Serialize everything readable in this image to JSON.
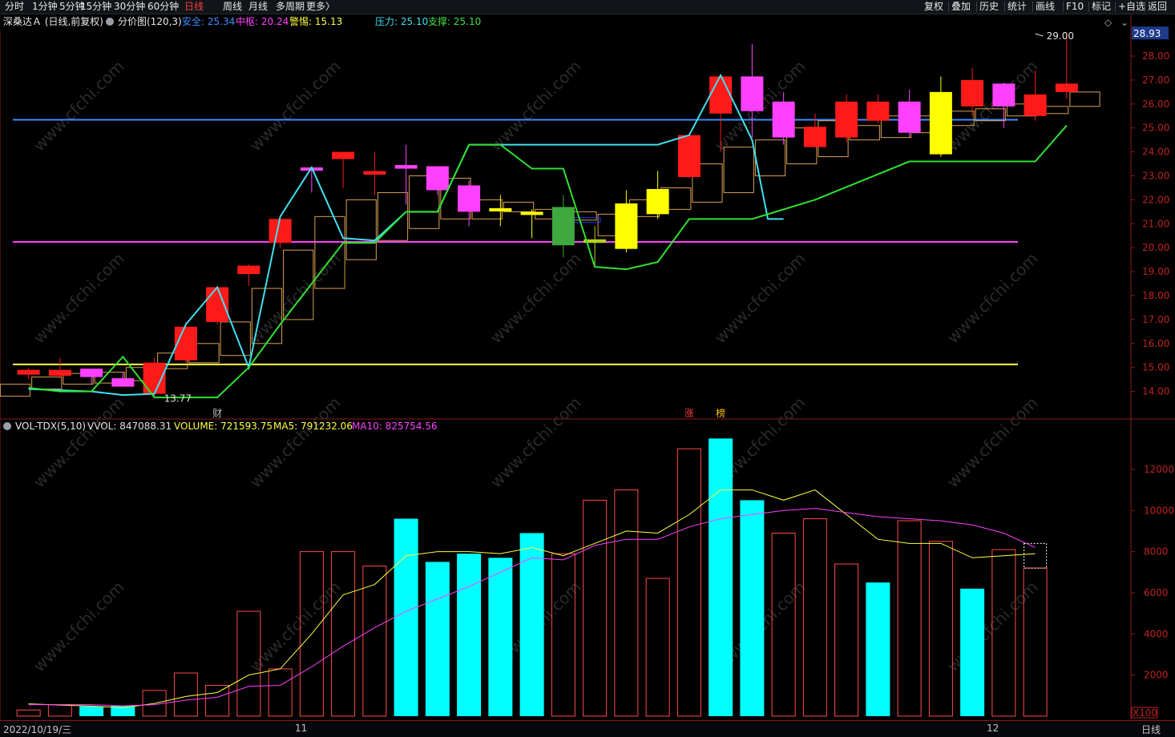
{
  "toolbar": {
    "periods": [
      "分时",
      "1分钟",
      "5分钟",
      "15分钟",
      "30分钟",
      "60分钟",
      "日线",
      "周线",
      "月线",
      "多周期",
      "更多〉"
    ],
    "active_period": "日线",
    "actions": [
      "复权",
      "叠加",
      "历史",
      "统计",
      "画线",
      "F10",
      "标记",
      "+自选",
      "返回"
    ]
  },
  "main_panel": {
    "stock": "深桑达Ａ (日线,前复权)",
    "indicator": "分价图(120,3)",
    "items": [
      {
        "label": "安全: 25.34",
        "color": "#3c8cff"
      },
      {
        "label": "中枢: 20.24",
        "color": "#ff40ff"
      },
      {
        "label": "警惕: 15.13",
        "color": "#ffff40"
      },
      {
        "label": "压力: 25.10",
        "color": "#40e0f0"
      },
      {
        "label": "支撑: 25.10",
        "color": "#40e040"
      }
    ],
    "current_price": "28.93",
    "high_label": "29.00",
    "low_label": "13.77",
    "markers": [
      {
        "text": "财",
        "color": "#bbbbbb",
        "bar": 6
      },
      {
        "text": "涨",
        "color": "#ff4040",
        "bar": 21
      },
      {
        "text": "榜",
        "color": "#ffc000",
        "bar": 22
      }
    ]
  },
  "vol_panel": {
    "title": "VOL-TDX(5,10)",
    "items": [
      {
        "label": "VVOL: 847088.31",
        "color": "#e0e0e0"
      },
      {
        "label": "VOLUME: 721593.75",
        "color": "#ffff40"
      },
      {
        "label": "MA5: 791232.06",
        "color": "#ffff40"
      },
      {
        "label": "MA10: 825754.56",
        "color": "#ff40ff"
      }
    ],
    "unit": "X100"
  },
  "bottom": {
    "date": "2022/10/19/三",
    "month_11": "11",
    "month_12": "12",
    "period": "日线"
  },
  "watermark": "www.cfchi.com",
  "chart_data": {
    "type": "candlestick",
    "price_axis": {
      "ticks": [
        "14.00",
        "15.00",
        "16.00",
        "17.00",
        "18.00",
        "19.00",
        "20.00",
        "21.00",
        "22.00",
        "23.00",
        "24.00",
        "25.00",
        "26.00",
        "27.00",
        "28.00"
      ],
      "range": [
        13.1,
        29.9
      ]
    },
    "volume_axis": {
      "ticks": [
        "2000",
        "4000",
        "6000",
        "8000",
        "10000",
        "12000"
      ],
      "range": [
        0,
        13900
      ]
    },
    "candles": [
      {
        "o": 14.7,
        "h": 14.95,
        "l": 14.5,
        "c": 14.9,
        "color": "red"
      },
      {
        "o": 14.65,
        "h": 15.4,
        "l": 14.55,
        "c": 14.9,
        "color": "red"
      },
      {
        "o": 14.6,
        "h": 14.95,
        "l": 14.3,
        "c": 14.95,
        "color": "magenta"
      },
      {
        "o": 14.2,
        "h": 14.8,
        "l": 14.2,
        "c": 14.55,
        "color": "magenta"
      },
      {
        "o": 13.9,
        "h": 15.4,
        "l": 13.8,
        "c": 15.2,
        "color": "red"
      },
      {
        "o": 15.3,
        "h": 16.9,
        "l": 15.2,
        "c": 16.7,
        "color": "red"
      },
      {
        "o": 16.9,
        "h": 18.4,
        "l": 16.8,
        "c": 18.35,
        "color": "red"
      },
      {
        "o": 18.9,
        "h": 19.3,
        "l": 18.4,
        "c": 19.25,
        "color": "red"
      },
      {
        "o": 20.2,
        "h": 21.2,
        "l": 20.0,
        "c": 21.2,
        "color": "red"
      },
      {
        "o": 23.25,
        "h": 23.4,
        "l": 22.3,
        "c": 23.35,
        "color": "magenta"
      },
      {
        "o": 23.7,
        "h": 24.0,
        "l": 22.5,
        "c": 24.0,
        "color": "red"
      },
      {
        "o": 23.05,
        "h": 24.0,
        "l": 22.2,
        "c": 23.2,
        "color": "red"
      },
      {
        "o": 23.3,
        "h": 24.3,
        "l": 21.8,
        "c": 23.45,
        "color": "magenta"
      },
      {
        "o": 22.4,
        "h": 23.4,
        "l": 22.2,
        "c": 23.4,
        "color": "magenta"
      },
      {
        "o": 22.6,
        "h": 22.8,
        "l": 20.9,
        "c": 21.5,
        "color": "magenta"
      },
      {
        "o": 21.6,
        "h": 22.2,
        "l": 20.9,
        "c": 21.65,
        "color": "yellow"
      },
      {
        "o": 21.5,
        "h": 21.6,
        "l": 20.4,
        "c": 21.5,
        "color": "yellow"
      },
      {
        "o": 21.7,
        "h": 22.2,
        "l": 19.6,
        "c": 20.1,
        "color": "green"
      },
      {
        "o": 20.2,
        "h": 20.9,
        "l": 19.2,
        "c": 20.35,
        "color": "yellowgreen"
      },
      {
        "o": 19.95,
        "h": 22.4,
        "l": 19.8,
        "c": 21.85,
        "color": "yellow"
      },
      {
        "o": 21.4,
        "h": 23.2,
        "l": 21.2,
        "c": 22.45,
        "color": "yellow"
      },
      {
        "o": 22.95,
        "h": 24.8,
        "l": 22.9,
        "c": 24.7,
        "color": "red"
      },
      {
        "o": 25.6,
        "h": 27.15,
        "l": 24.0,
        "c": 27.15,
        "color": "red"
      },
      {
        "o": 25.7,
        "h": 28.5,
        "l": 24.6,
        "c": 27.15,
        "color": "magenta"
      },
      {
        "o": 24.6,
        "h": 26.5,
        "l": 24.3,
        "c": 26.1,
        "color": "magenta"
      },
      {
        "o": 24.2,
        "h": 25.6,
        "l": 24.2,
        "c": 25.05,
        "color": "red"
      },
      {
        "o": 24.6,
        "h": 26.4,
        "l": 24.4,
        "c": 26.1,
        "color": "red"
      },
      {
        "o": 25.3,
        "h": 26.4,
        "l": 25.2,
        "c": 26.1,
        "color": "red"
      },
      {
        "o": 24.8,
        "h": 26.6,
        "l": 24.6,
        "c": 26.1,
        "color": "magenta"
      },
      {
        "o": 23.9,
        "h": 27.15,
        "l": 23.8,
        "c": 26.5,
        "color": "yellow"
      },
      {
        "o": 25.9,
        "h": 27.5,
        "l": 25.5,
        "c": 27.0,
        "color": "red"
      },
      {
        "o": 25.9,
        "h": 26.9,
        "l": 25.0,
        "c": 26.85,
        "color": "magenta"
      },
      {
        "o": 25.5,
        "h": 27.4,
        "l": 25.3,
        "c": 26.4,
        "color": "red"
      },
      {
        "o": 26.5,
        "h": 29.0,
        "l": 26.2,
        "c": 26.85,
        "color": "red"
      }
    ],
    "boxes": [
      [
        13.8,
        14.3
      ],
      [
        14.1,
        14.6
      ],
      [
        14.3,
        14.75
      ],
      [
        14.35,
        14.8
      ],
      [
        14.45,
        15.0
      ],
      [
        14.95,
        15.6
      ],
      [
        15.2,
        16.0
      ],
      [
        15.5,
        16.9
      ],
      [
        16.0,
        18.3
      ],
      [
        17.0,
        19.9
      ],
      [
        18.3,
        21.3
      ],
      [
        19.5,
        22.0
      ],
      [
        20.3,
        22.3
      ],
      [
        20.8,
        23.0
      ],
      [
        21.2,
        22.9
      ],
      [
        21.2,
        22.0
      ],
      [
        21.5,
        21.9
      ],
      [
        21.2,
        21.6
      ],
      [
        21.15,
        21.5
      ],
      [
        20.5,
        21.4
      ],
      [
        21.3,
        22.0
      ],
      [
        21.6,
        22.5
      ],
      [
        21.9,
        23.5
      ],
      [
        22.3,
        24.2
      ],
      [
        23.0,
        24.5
      ],
      [
        23.5,
        25.0
      ],
      [
        23.8,
        25.3
      ],
      [
        24.5,
        25.1
      ],
      [
        24.6,
        25.5
      ],
      [
        24.8,
        25.5
      ],
      [
        25.1,
        25.7
      ],
      [
        25.3,
        25.8
      ],
      [
        25.5,
        26.0
      ],
      [
        25.6,
        25.9
      ],
      [
        25.9,
        26.5
      ]
    ],
    "hlines": [
      {
        "name": "安全",
        "value": 25.34,
        "color": "#3c8cff"
      },
      {
        "name": "中枢",
        "value": 20.24,
        "color": "#ff40ff"
      },
      {
        "name": "警惕",
        "value": 15.13,
        "color": "#ffff40"
      }
    ],
    "pressure_line": [
      {
        "i": 0,
        "v": 14.1
      },
      {
        "i": 2,
        "v": 14.0
      },
      {
        "i": 3,
        "v": 13.85
      },
      {
        "i": 4,
        "v": 13.9
      },
      {
        "i": 5,
        "v": 16.8
      },
      {
        "i": 6,
        "v": 18.35
      },
      {
        "i": 7,
        "v": 15.0
      },
      {
        "i": 8,
        "v": 21.3
      },
      {
        "i": 9,
        "v": 23.35
      },
      {
        "i": 10,
        "v": 20.4
      },
      {
        "i": 11,
        "v": 20.3
      },
      {
        "i": 12,
        "v": 21.5
      },
      {
        "i": 13,
        "v": 21.5
      },
      {
        "i": 14,
        "v": 24.3
      },
      {
        "i": 15,
        "v": 24.3
      },
      {
        "i": 19,
        "v": 24.3
      },
      {
        "i": 20,
        "v": 24.3
      },
      {
        "i": 21,
        "v": 24.7
      },
      {
        "i": 22,
        "v": 27.2
      },
      {
        "i": 23,
        "v": 24.5
      },
      {
        "i": 23.5,
        "v": 21.2
      },
      {
        "i": 24,
        "v": 21.2
      }
    ],
    "support_line": [
      {
        "i": 0,
        "v": 14.15
      },
      {
        "i": 1,
        "v": 14.0
      },
      {
        "i": 2,
        "v": 14.0
      },
      {
        "i": 3,
        "v": 15.45
      },
      {
        "i": 4,
        "v": 13.75
      },
      {
        "i": 5,
        "v": 13.75
      },
      {
        "i": 6,
        "v": 13.75
      },
      {
        "i": 7,
        "v": 15.0
      },
      {
        "i": 8,
        "v": 16.8
      },
      {
        "i": 9,
        "v": 18.5
      },
      {
        "i": 10,
        "v": 20.2
      },
      {
        "i": 11,
        "v": 20.2
      },
      {
        "i": 12,
        "v": 21.5
      },
      {
        "i": 13,
        "v": 21.5
      },
      {
        "i": 14,
        "v": 24.3
      },
      {
        "i": 15,
        "v": 24.3
      },
      {
        "i": 16,
        "v": 23.3
      },
      {
        "i": 17,
        "v": 23.3
      },
      {
        "i": 18,
        "v": 19.2
      },
      {
        "i": 19,
        "v": 19.1
      },
      {
        "i": 20,
        "v": 19.4
      },
      {
        "i": 21,
        "v": 21.2
      },
      {
        "i": 23,
        "v": 21.2
      },
      {
        "i": 25,
        "v": 22.0
      },
      {
        "i": 28,
        "v": 23.6
      },
      {
        "i": 32,
        "v": 23.6
      },
      {
        "i": 33,
        "v": 25.1
      }
    ],
    "volume": [
      300,
      560,
      480,
      500,
      1250,
      2100,
      1500,
      5100,
      2300,
      8000,
      8000,
      7300,
      9600,
      7500,
      7900,
      7700,
      8900,
      7900,
      10500,
      11000,
      6700,
      13000,
      13500,
      10500,
      8900,
      9600,
      7400,
      6500,
      9500,
      8500,
      6200,
      8100,
      7200
    ],
    "volume_colors": [
      "r",
      "r",
      "c",
      "c",
      "r",
      "r",
      "r",
      "r",
      "r",
      "r",
      "r",
      "r",
      "c",
      "c",
      "c",
      "c",
      "c",
      "r",
      "r",
      "r",
      "r",
      "r",
      "c",
      "c",
      "r",
      "r",
      "r",
      "c",
      "r",
      "r",
      "c",
      "r",
      "r"
    ],
    "ma5": [
      600,
      540,
      490,
      410,
      620,
      960,
      1150,
      2000,
      2300,
      4000,
      5900,
      6400,
      7800,
      8000,
      8000,
      7900,
      8200,
      7800,
      8400,
      9000,
      8900,
      9800,
      11000,
      11000,
      10500,
      11000,
      9800,
      8600,
      8400,
      8400,
      7700,
      7800,
      7900
    ],
    "ma10": [
      560,
      560,
      560,
      500,
      560,
      780,
      920,
      1450,
      1500,
      2400,
      3400,
      4300,
      5100,
      5700,
      6300,
      7000,
      7700,
      7600,
      8300,
      8600,
      8600,
      9200,
      9600,
      9800,
      10000,
      10100,
      9900,
      9700,
      9600,
      9500,
      9300,
      8900,
      8200
    ]
  }
}
